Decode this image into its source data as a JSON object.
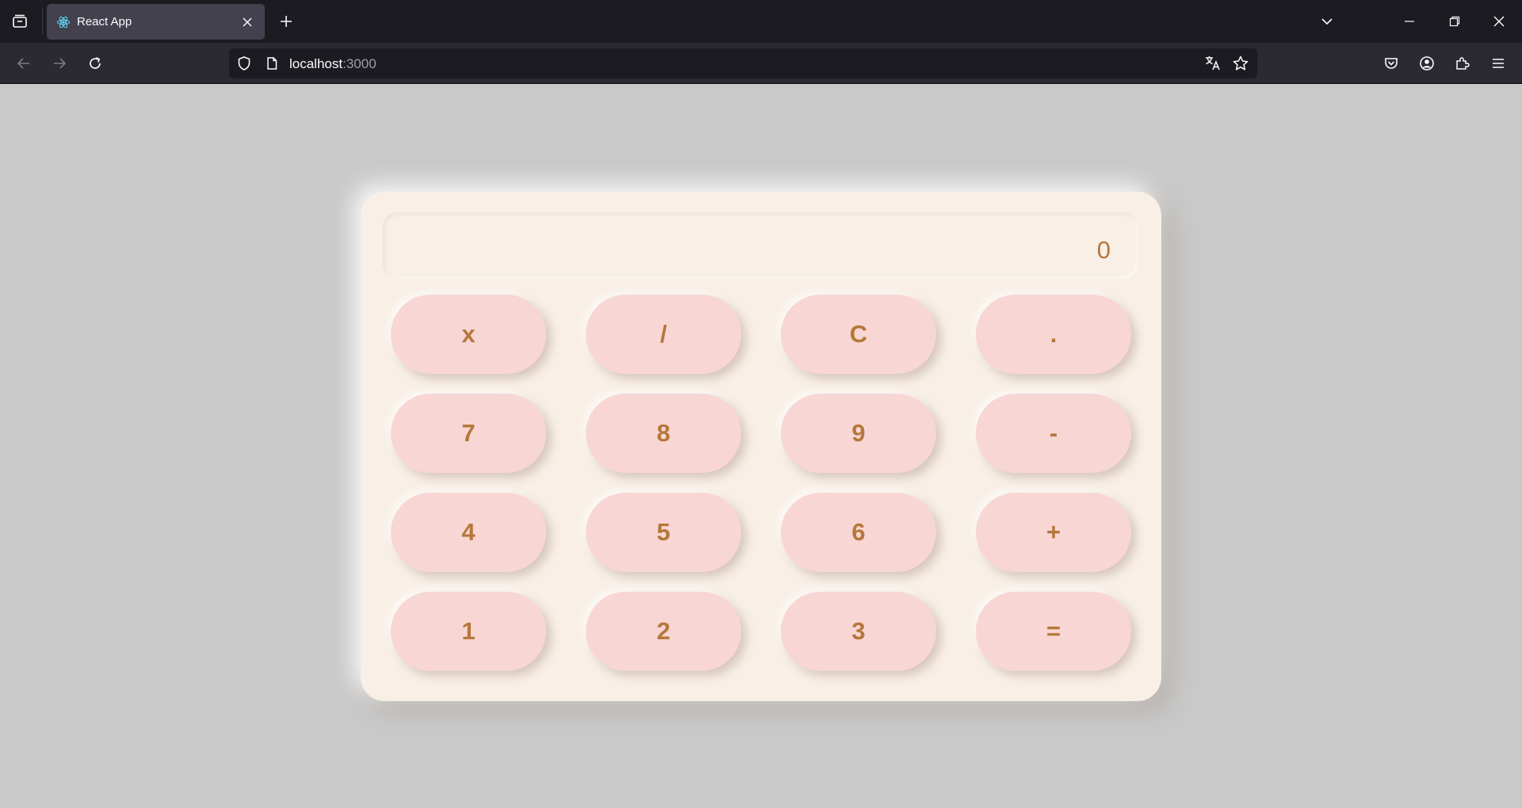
{
  "browser": {
    "tab": {
      "title": "React App",
      "favicon": "react-logo-icon"
    },
    "url": {
      "host": "localhost",
      "port": ":3000"
    }
  },
  "calculator": {
    "display": "0",
    "colors": {
      "background": "#c9c9c9",
      "panel": "#f8efe6",
      "key": "#f8d6d4",
      "text": "#b5773a"
    },
    "keys": [
      [
        "x",
        "/",
        "C",
        "."
      ],
      [
        "7",
        "8",
        "9",
        "-"
      ],
      [
        "4",
        "5",
        "6",
        "+"
      ],
      [
        "1",
        "2",
        "3",
        "="
      ]
    ]
  }
}
